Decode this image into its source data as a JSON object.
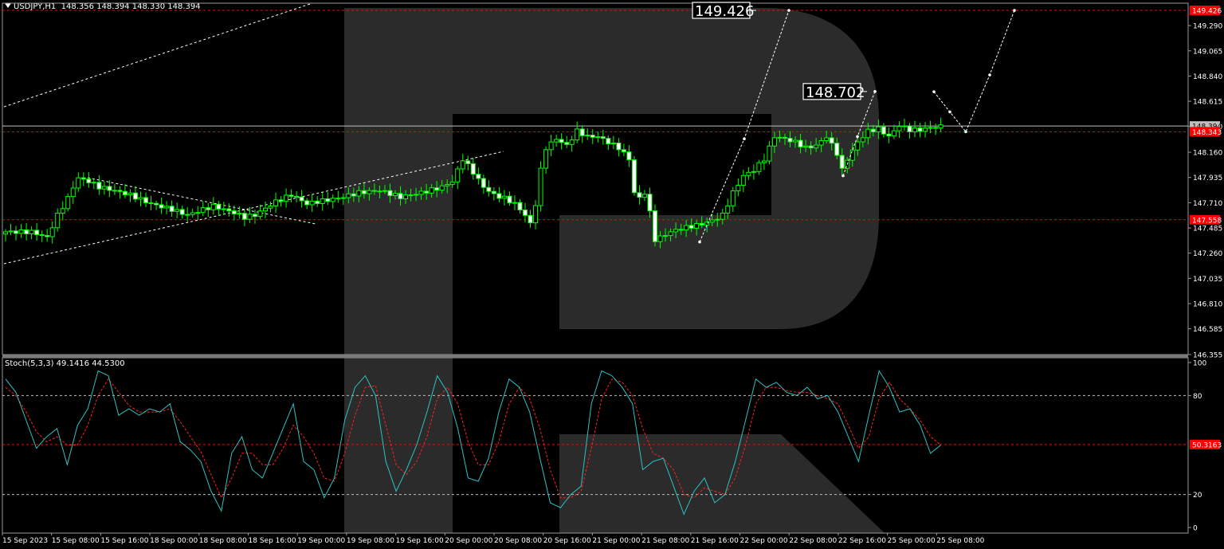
{
  "header": {
    "symbol": "USDJPY,H1",
    "ohlc": "148.356 148.394 148.330 148.394"
  },
  "stoch_header": {
    "name": "Stoch(5,3,3)",
    "values": "49.1416 44.5300"
  },
  "colors": {
    "bull": "#00ff00",
    "bear": "#ffffff",
    "level_line": "#ff0000",
    "stoch_main": "#2ec2c2",
    "stoch_signal": "#ff2020",
    "watermark": "#2b2b2b",
    "axis_text": "#ffffff",
    "label_bg_red": "#ff0000"
  },
  "chart_data": [
    {
      "type": "candlestick",
      "symbol": "USDJPY",
      "timeframe": "H1",
      "ylim": [
        146.355,
        149.49
      ],
      "y_ticks": [
        "149.290",
        "149.065",
        "148.840",
        "148.615",
        "148.390",
        "148.160",
        "147.935",
        "147.710",
        "147.485",
        "147.260",
        "147.035",
        "146.810",
        "146.585",
        "146.355"
      ],
      "price_labels": [
        {
          "text": "149.426",
          "value": 149.426,
          "style": "red"
        },
        {
          "text": "148.394",
          "value": 148.394,
          "style": "gray"
        },
        {
          "text": "148.343",
          "value": 148.343,
          "style": "red"
        },
        {
          "text": "147.558",
          "value": 147.558,
          "style": "red"
        }
      ],
      "levels": [
        149.426,
        148.343,
        147.558
      ],
      "current_price_line": 148.394,
      "x_labels": [
        "15 Sep 2023",
        "15 Sep 08:00",
        "15 Sep 16:00",
        "18 Sep 00:00",
        "18 Sep 08:00",
        "18 Sep 16:00",
        "19 Sep 00:00",
        "19 Sep 08:00",
        "19 Sep 16:00",
        "20 Sep 00:00",
        "20 Sep 08:00",
        "20 Sep 16:00",
        "21 Sep 00:00",
        "21 Sep 08:00",
        "21 Sep 16:00",
        "22 Sep 00:00",
        "22 Sep 08:00",
        "22 Sep 16:00",
        "25 Sep 00:00",
        "25 Sep 08:00"
      ],
      "annotations": [
        {
          "text": "149.426",
          "value": 149.426
        },
        {
          "text": "148.702",
          "value": 148.702
        }
      ],
      "close_path": [
        [
          0,
          147.45
        ],
        [
          5,
          147.45
        ],
        [
          8,
          147.4
        ],
        [
          10,
          147.6
        ],
        [
          12,
          147.75
        ],
        [
          13,
          147.85
        ],
        [
          14,
          147.93
        ],
        [
          16,
          147.9
        ],
        [
          18,
          147.85
        ],
        [
          20,
          147.83
        ],
        [
          24,
          147.78
        ],
        [
          28,
          147.7
        ],
        [
          32,
          147.65
        ],
        [
          35,
          147.6
        ],
        [
          38,
          147.65
        ],
        [
          40,
          147.68
        ],
        [
          44,
          147.62
        ],
        [
          46,
          147.58
        ],
        [
          48,
          147.6
        ],
        [
          50,
          147.66
        ],
        [
          52,
          147.72
        ],
        [
          55,
          147.78
        ],
        [
          58,
          147.7
        ],
        [
          60,
          147.72
        ],
        [
          64,
          147.75
        ],
        [
          68,
          147.8
        ],
        [
          72,
          147.82
        ],
        [
          76,
          147.76
        ],
        [
          80,
          147.8
        ],
        [
          84,
          147.85
        ],
        [
          86,
          147.9
        ],
        [
          88,
          148.1
        ],
        [
          90,
          147.98
        ],
        [
          92,
          147.85
        ],
        [
          94,
          147.78
        ],
        [
          96,
          147.75
        ],
        [
          98,
          147.7
        ],
        [
          100,
          147.6
        ],
        [
          101,
          147.52
        ],
        [
          102,
          147.7
        ],
        [
          103,
          148.0
        ],
        [
          104,
          148.2
        ],
        [
          106,
          148.28
        ],
        [
          108,
          148.22
        ],
        [
          110,
          148.35
        ],
        [
          112,
          148.3
        ],
        [
          114,
          148.3
        ],
        [
          116,
          148.25
        ],
        [
          118,
          148.2
        ],
        [
          120,
          148.1
        ],
        [
          121,
          147.8
        ],
        [
          122,
          147.75
        ],
        [
          123,
          147.8
        ],
        [
          124,
          147.62
        ],
        [
          125,
          147.38
        ],
        [
          126,
          147.4
        ],
        [
          128,
          147.45
        ],
        [
          130,
          147.48
        ],
        [
          134,
          147.52
        ],
        [
          136,
          147.55
        ],
        [
          138,
          147.6
        ],
        [
          140,
          147.8
        ],
        [
          142,
          147.95
        ],
        [
          144,
          148.0
        ],
        [
          146,
          148.1
        ],
        [
          148,
          148.3
        ],
        [
          150,
          148.28
        ],
        [
          152,
          148.25
        ],
        [
          154,
          148.2
        ],
        [
          156,
          148.22
        ],
        [
          158,
          148.3
        ],
        [
          160,
          148.15
        ],
        [
          161,
          148.0
        ],
        [
          162,
          148.1
        ],
        [
          164,
          148.25
        ],
        [
          166,
          148.35
        ],
        [
          168,
          148.37
        ],
        [
          170,
          148.3
        ],
        [
          172,
          148.4
        ],
        [
          174,
          148.36
        ],
        [
          176,
          148.36
        ],
        [
          178,
          148.38
        ],
        [
          180,
          148.39
        ]
      ]
    },
    {
      "type": "line",
      "name": "Stoch(5,3,3)",
      "ylim": [
        0,
        100
      ],
      "y_ticks": [
        "100",
        "80",
        "50.3163",
        "20",
        "0"
      ],
      "levels": [
        80,
        50.3163,
        20
      ],
      "last_values": {
        "main": 49.1416,
        "signal": 44.53
      },
      "series": [
        {
          "name": "main",
          "values": [
            90,
            82,
            65,
            48,
            55,
            60,
            38,
            62,
            72,
            95,
            92,
            68,
            72,
            68,
            72,
            70,
            75,
            52,
            47,
            40,
            22,
            10,
            45,
            55,
            35,
            30,
            45,
            60,
            75,
            40,
            35,
            18,
            30,
            65,
            85,
            92,
            80,
            40,
            22,
            35,
            50,
            70,
            92,
            82,
            60,
            30,
            28,
            42,
            70,
            90,
            85,
            70,
            42,
            15,
            12,
            20,
            25,
            75,
            95,
            92,
            85,
            75,
            35,
            40,
            42,
            25,
            8,
            22,
            30,
            15,
            20,
            40,
            65,
            90,
            85,
            88,
            82,
            80,
            85,
            78,
            80,
            70,
            55,
            40,
            68,
            95,
            85,
            70,
            72,
            62,
            45,
            50
          ]
        },
        {
          "name": "signal",
          "values": [
            85,
            80,
            70,
            58,
            52,
            55,
            50,
            50,
            62,
            80,
            90,
            82,
            74,
            70,
            70,
            70,
            72,
            64,
            55,
            46,
            32,
            18,
            30,
            45,
            45,
            38,
            38,
            48,
            62,
            55,
            45,
            30,
            28,
            45,
            68,
            85,
            86,
            62,
            38,
            32,
            40,
            55,
            78,
            85,
            75,
            52,
            38,
            38,
            52,
            75,
            85,
            78,
            60,
            35,
            18,
            18,
            22,
            48,
            78,
            90,
            88,
            80,
            60,
            45,
            42,
            35,
            20,
            18,
            24,
            22,
            20,
            30,
            50,
            75,
            85,
            85,
            83,
            82,
            82,
            80,
            78,
            75,
            62,
            48,
            55,
            78,
            88,
            78,
            72,
            65,
            55,
            50
          ]
        }
      ]
    }
  ]
}
